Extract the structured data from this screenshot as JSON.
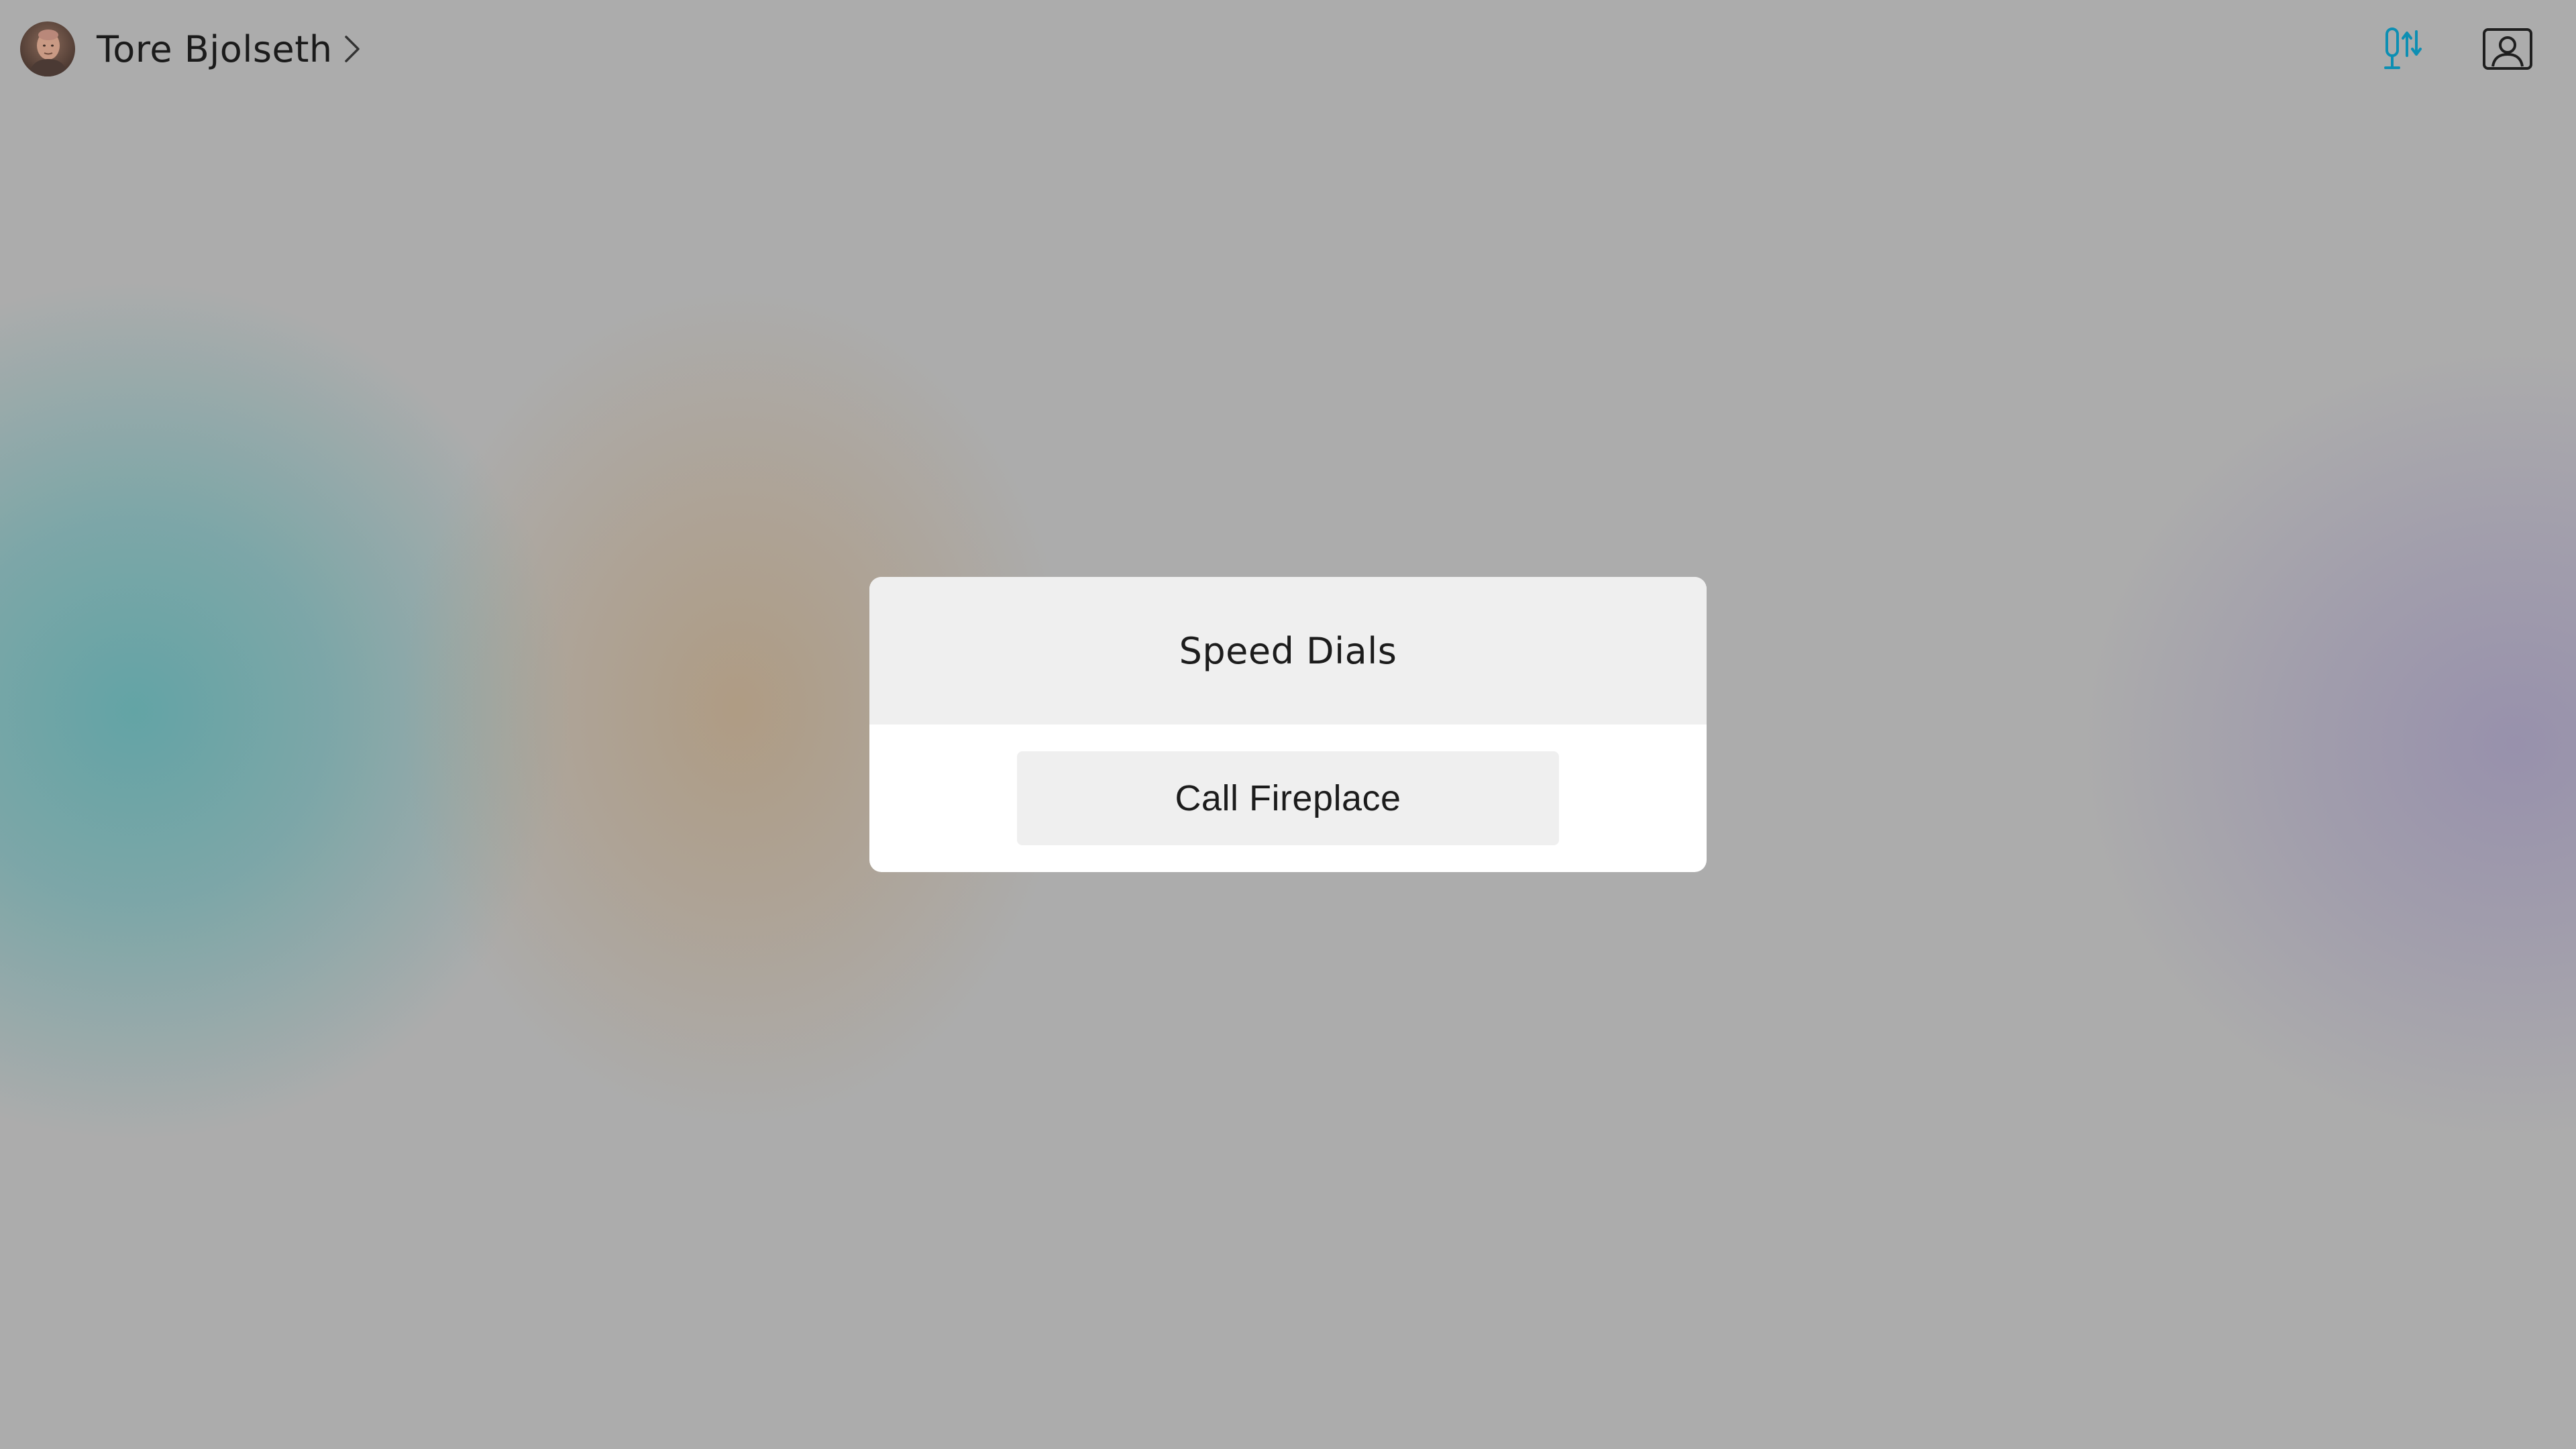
{
  "header": {
    "user_name": "Tore Bjolseth",
    "avatar_icon": "user-avatar-photo",
    "chevron_icon": "chevron-right-icon",
    "mic_settings_icon": "microphone-settings-icon",
    "selfview_icon": "selfview-person-icon",
    "accent_color": "#0d8fb3"
  },
  "dialog": {
    "title": "Speed Dials",
    "items": [
      {
        "label": "Call Fireplace"
      }
    ]
  },
  "colors": {
    "background": "#acacac",
    "dialog_header": "#efefef",
    "dialog_body": "#ffffff",
    "button": "#efefef",
    "text": "#1c1c1c"
  }
}
